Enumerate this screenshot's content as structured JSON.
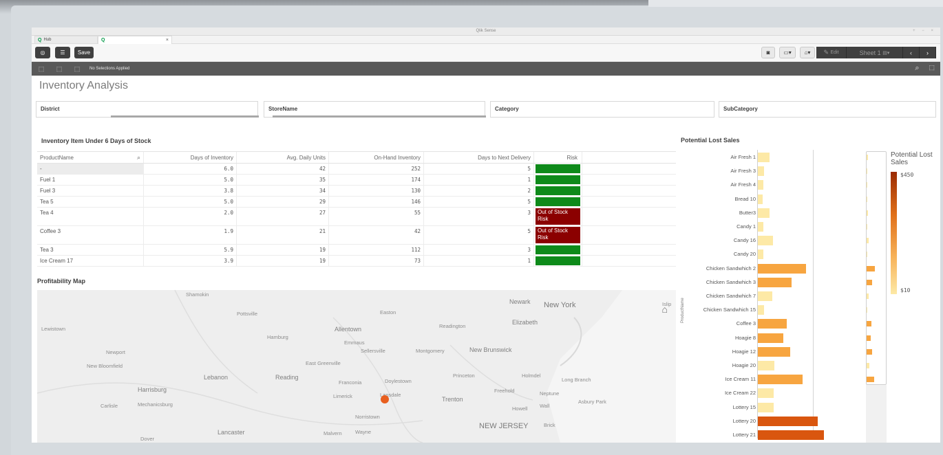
{
  "window": {
    "title": "Qlik Sense",
    "controls": "+ − ×"
  },
  "tabs": [
    {
      "label": "Hub"
    },
    {
      "label": ""
    }
  ],
  "toolbar": {
    "save_label": "Save",
    "edit_label": "Edit",
    "sheet_label": "Sheet 1"
  },
  "selections": {
    "status": "No Selections Applied"
  },
  "sheet": {
    "title": "Inventory Analysis"
  },
  "filters": [
    {
      "label": "District"
    },
    {
      "label": "StoreName"
    },
    {
      "label": "Category"
    },
    {
      "label": "SubCategory"
    }
  ],
  "table": {
    "title": "Inventory Item Under 6 Days of Stock",
    "columns": [
      "ProductName",
      "Days of Inventory",
      "Avg. Daily Units",
      "On-Hand Inventory",
      "Days to Next Delivery",
      "Risk"
    ],
    "rows": [
      {
        "name": "-",
        "days": "6.0",
        "avg": "42",
        "onhand": "252",
        "next": "5",
        "risk": "",
        "riskColor": "#0e8a1a"
      },
      {
        "name": "Fuel 1",
        "days": "5.0",
        "avg": "35",
        "onhand": "174",
        "next": "1",
        "risk": "",
        "riskColor": "#0e8a1a"
      },
      {
        "name": "Fuel 3",
        "days": "3.8",
        "avg": "34",
        "onhand": "130",
        "next": "2",
        "risk": "",
        "riskColor": "#0e8a1a"
      },
      {
        "name": "Tea 5",
        "days": "5.0",
        "avg": "29",
        "onhand": "146",
        "next": "5",
        "risk": "",
        "riskColor": "#0e8a1a"
      },
      {
        "name": "Tea 4",
        "days": "2.0",
        "avg": "27",
        "onhand": "55",
        "next": "3",
        "risk": "Out of Stock Risk",
        "riskColor": "#8b0000"
      },
      {
        "name": "Coffee 3",
        "days": "1.9",
        "avg": "21",
        "onhand": "42",
        "next": "5",
        "risk": "Out of Stock Risk",
        "riskColor": "#8b0000"
      },
      {
        "name": "Tea 3",
        "days": "5.9",
        "avg": "19",
        "onhand": "112",
        "next": "3",
        "risk": "",
        "riskColor": "#0e8a1a"
      },
      {
        "name": "Ice Cream 17",
        "days": "3.9",
        "avg": "19",
        "onhand": "73",
        "next": "1",
        "risk": "",
        "riskColor": "#0e8a1a"
      }
    ]
  },
  "map": {
    "title": "Profitability Map",
    "places": [
      {
        "name": "Shamokin",
        "cls": ""
      },
      {
        "name": "Pottsville",
        "cls": ""
      },
      {
        "name": "Lewistown",
        "cls": ""
      },
      {
        "name": "Hamburg",
        "cls": ""
      },
      {
        "name": "Allentown",
        "cls": "mid"
      },
      {
        "name": "Emmaus",
        "cls": ""
      },
      {
        "name": "Easton",
        "cls": ""
      },
      {
        "name": "Readington",
        "cls": ""
      },
      {
        "name": "Newark",
        "cls": "mid"
      },
      {
        "name": "New York",
        "cls": "big"
      },
      {
        "name": "Elizabeth",
        "cls": "mid"
      },
      {
        "name": "Islip",
        "cls": ""
      },
      {
        "name": "Newport",
        "cls": ""
      },
      {
        "name": "New Bloomfield",
        "cls": ""
      },
      {
        "name": "East Greenville",
        "cls": ""
      },
      {
        "name": "Sellersville",
        "cls": ""
      },
      {
        "name": "Montgomery",
        "cls": ""
      },
      {
        "name": "New Brunswick",
        "cls": "mid"
      },
      {
        "name": "Lebanon",
        "cls": "mid"
      },
      {
        "name": "Reading",
        "cls": "mid"
      },
      {
        "name": "Franconia",
        "cls": ""
      },
      {
        "name": "Doylestown",
        "cls": ""
      },
      {
        "name": "Princeton",
        "cls": ""
      },
      {
        "name": "Holmdel",
        "cls": ""
      },
      {
        "name": "Long Branch",
        "cls": ""
      },
      {
        "name": "Harrisburg",
        "cls": "mid"
      },
      {
        "name": "Limerick",
        "cls": ""
      },
      {
        "name": "Lansdale",
        "cls": ""
      },
      {
        "name": "Trenton",
        "cls": "mid"
      },
      {
        "name": "Freehold",
        "cls": ""
      },
      {
        "name": "Neptune",
        "cls": ""
      },
      {
        "name": "Carlisle",
        "cls": ""
      },
      {
        "name": "Mechanicsburg",
        "cls": ""
      },
      {
        "name": "Asbury Park",
        "cls": ""
      },
      {
        "name": "Howell",
        "cls": ""
      },
      {
        "name": "Wall",
        "cls": ""
      },
      {
        "name": "Norristown",
        "cls": ""
      },
      {
        "name": "Lancaster",
        "cls": "mid"
      },
      {
        "name": "Malvern",
        "cls": ""
      },
      {
        "name": "Wayne",
        "cls": ""
      },
      {
        "name": "NEW JERSEY",
        "cls": "big"
      },
      {
        "name": "Brick",
        "cls": ""
      },
      {
        "name": "Dover",
        "cls": ""
      }
    ]
  },
  "chart_data": {
    "type": "bar",
    "orientation": "horizontal",
    "title": "Potential Lost Sales",
    "ylabel": "ProductName",
    "categories": [
      "Air Fresh 1",
      "Air Fresh 3",
      "Air Fresh 4",
      "Bread 10",
      "Butter3",
      "Candy 1",
      "Candy 16",
      "Candy 20",
      "Chicken Sandwhich 2",
      "Chicken Sandwhich 3",
      "Chicken Sandwhich 7",
      "Chicken Sandwhich 15",
      "Coffee 3",
      "Hoagie 8",
      "Hoagie 12",
      "Hoagie 20",
      "Ice Cream 11",
      "Ice Cream 22",
      "Lottery 15",
      "Lottery 20",
      "Lottery 21"
    ],
    "values": [
      20,
      10,
      9,
      8,
      19,
      9,
      25,
      9,
      80,
      56,
      24,
      10,
      48,
      42,
      54,
      28,
      74,
      26,
      26,
      100,
      110
    ],
    "legend": {
      "title": "Potential Lost Sales",
      "max_label": "$450",
      "min_label": "$10"
    },
    "colors": {
      "low": "#fde9a6",
      "mid": "#f7a540",
      "high": "#d9560f"
    }
  }
}
